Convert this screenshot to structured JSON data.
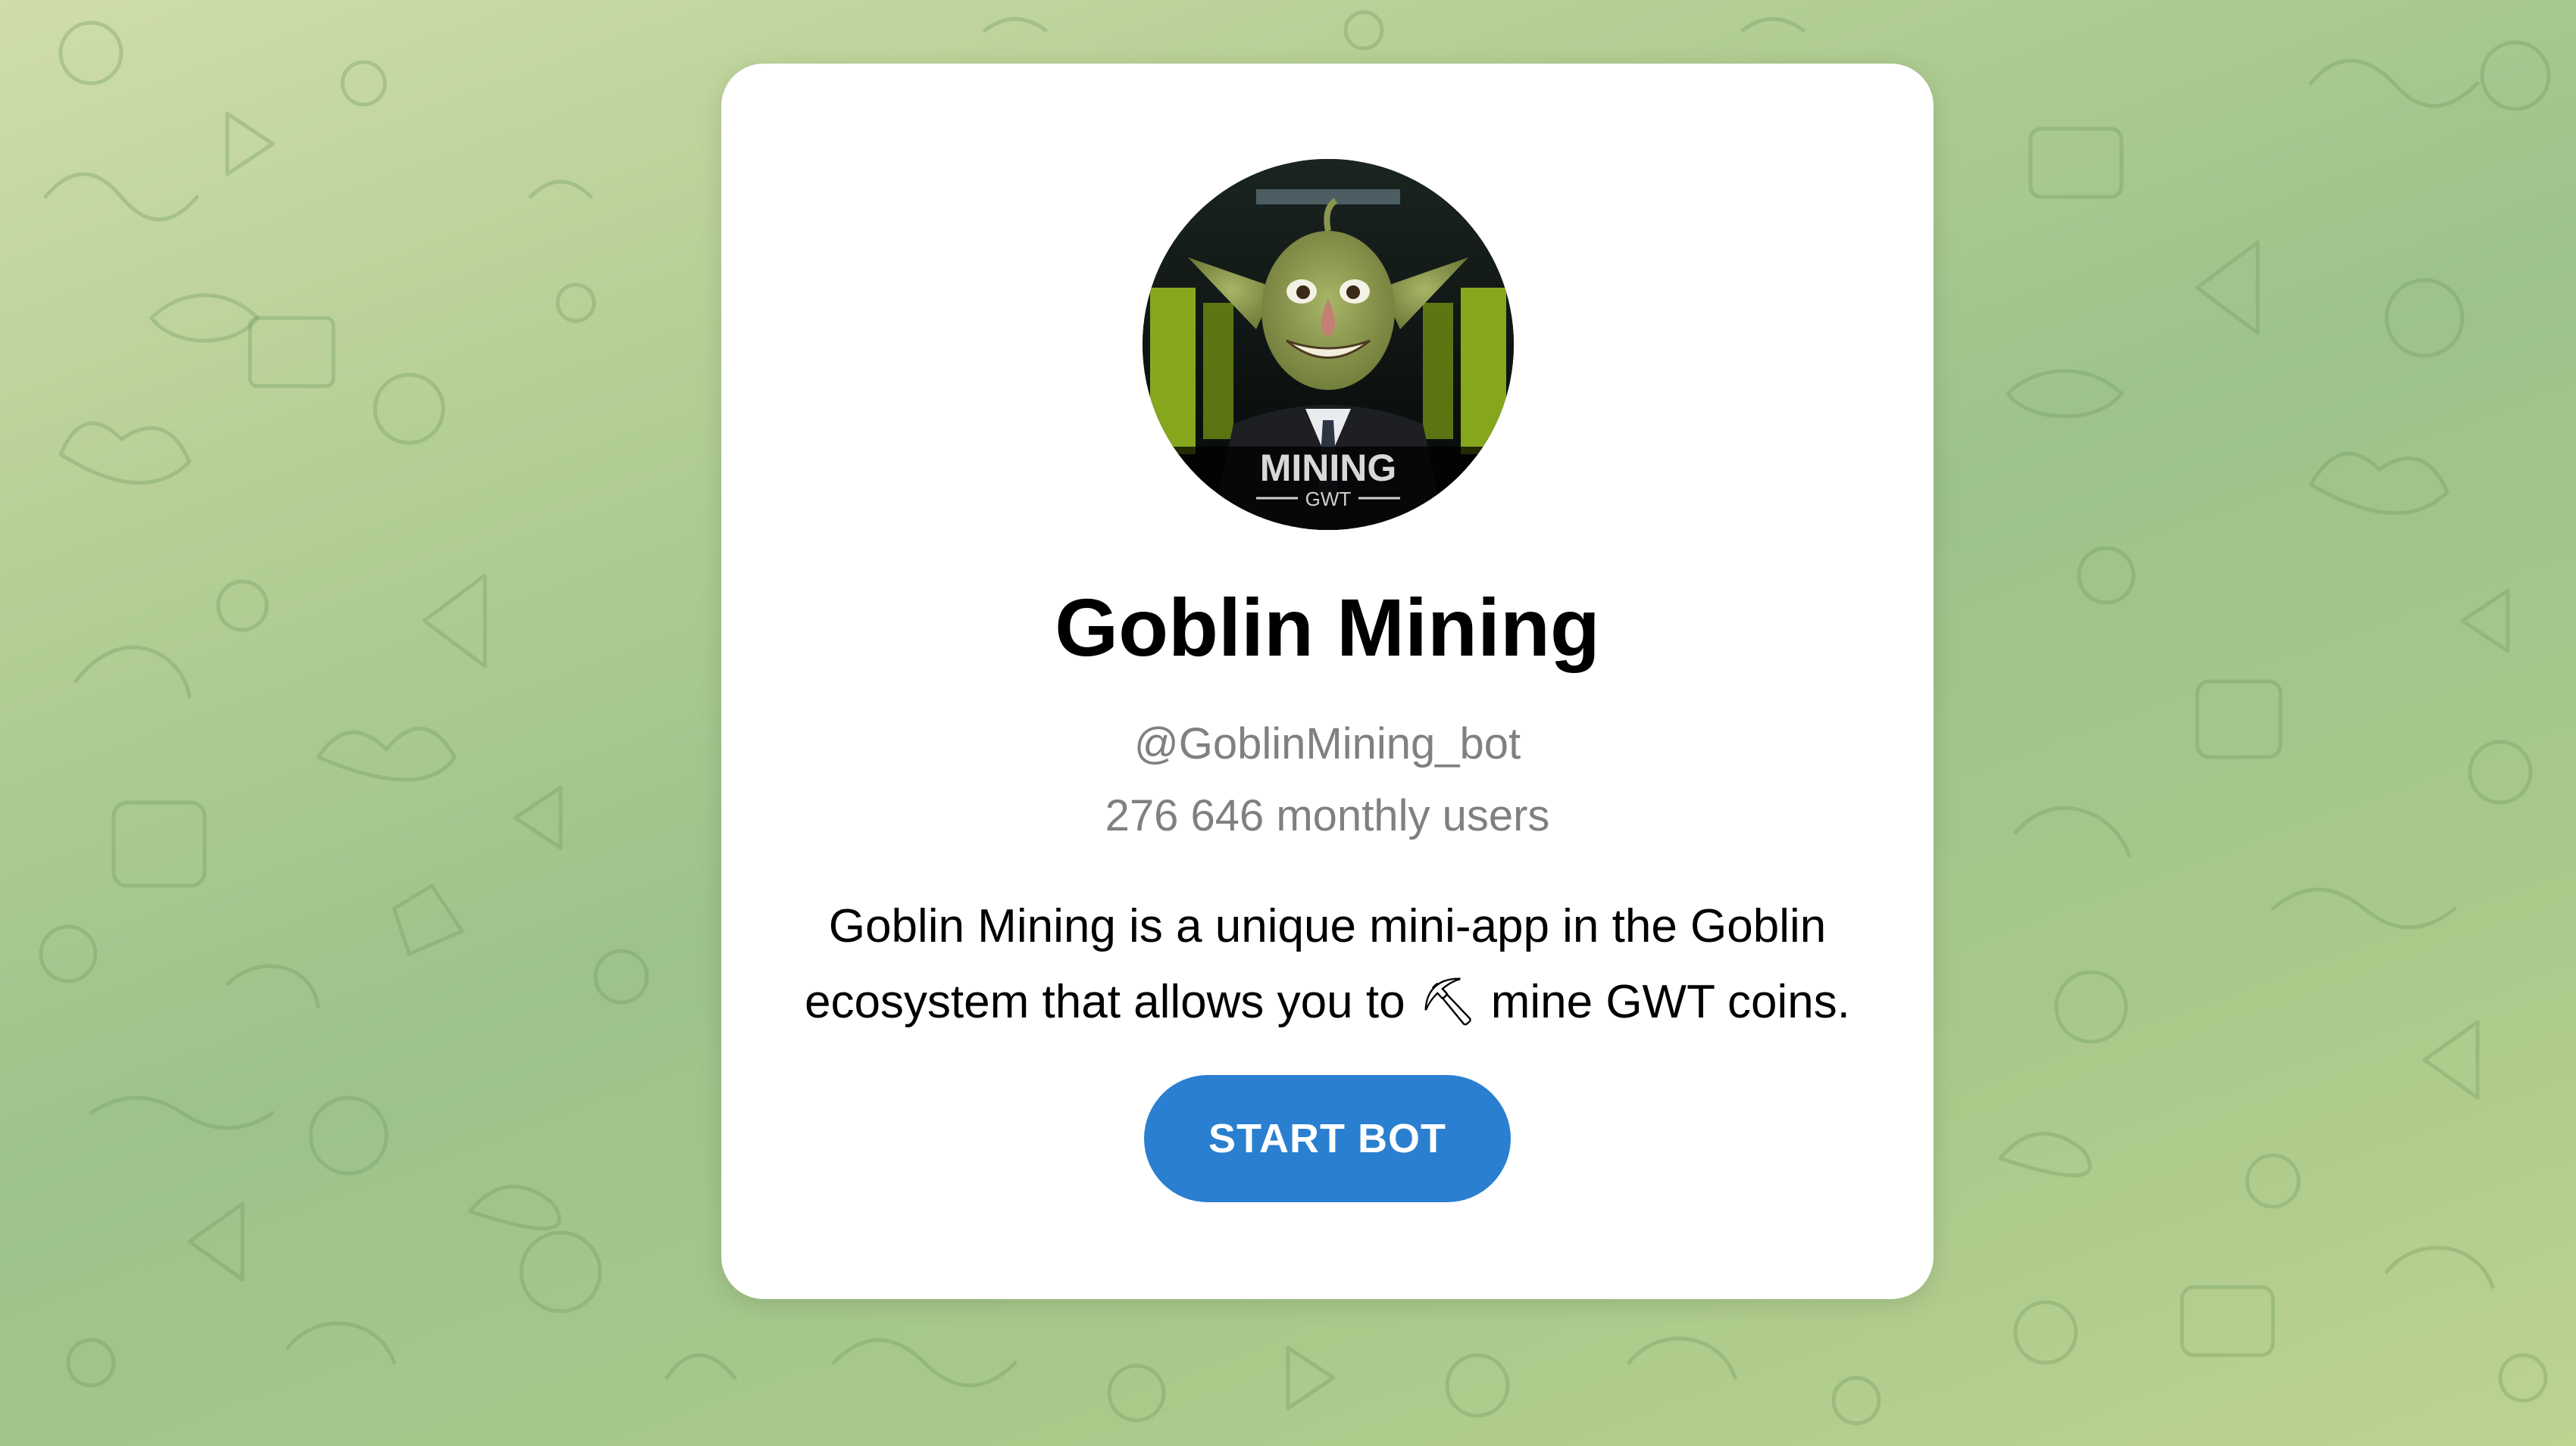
{
  "bot": {
    "name": "Goblin Mining",
    "username": "@GoblinMining_bot",
    "monthly_users": "276 646 monthly users",
    "description": "Goblin Mining is a unique mini-app in the Goblin ecosystem that allows you to ⛏ mine GWT coins.",
    "avatar_text": "MINING",
    "avatar_subtext": "GWT"
  },
  "actions": {
    "start_label": "START BOT"
  },
  "colors": {
    "button": "#2a7fd0",
    "card": "#ffffff",
    "background_green": "#a9c98a"
  }
}
